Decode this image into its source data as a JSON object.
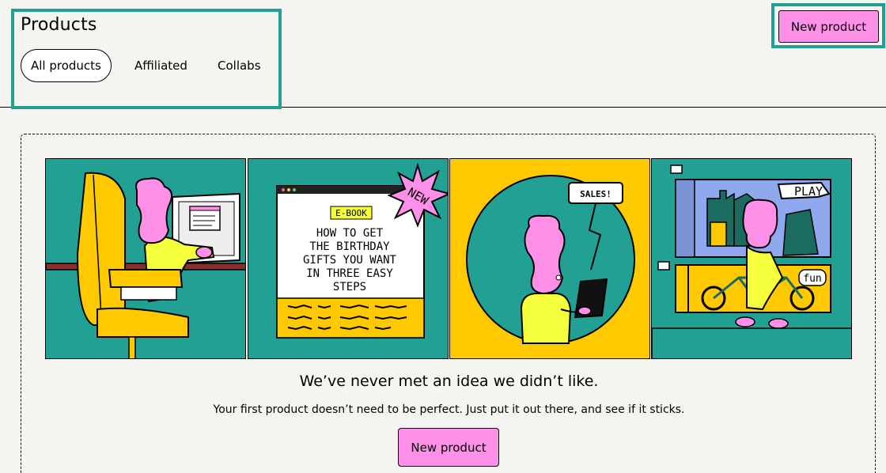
{
  "header": {
    "title": "Products",
    "tabs": [
      {
        "label": "All products",
        "active": true
      },
      {
        "label": "Affiliated",
        "active": false
      },
      {
        "label": "Collabs",
        "active": false
      }
    ],
    "new_product_label": "New product"
  },
  "empty_state": {
    "headline": "We’ve never met an idea we didn’t like.",
    "subline": "Your first product doesn’t need to be perfect. Just put it out there, and see if it sticks.",
    "cta_label": "New product",
    "illustrations": {
      "ebook_badge": "E-BOOK",
      "ebook_title_lines": [
        "HOW TO GET",
        "THE BIRTHDAY",
        "GIFTS YOU WANT",
        "IN THREE EASY",
        "STEPS"
      ],
      "new_burst": "NEW",
      "speech_bubble": "SALES!",
      "play_sign": "PLAY",
      "fun_sign": "fun"
    }
  },
  "colors": {
    "accent_teal": "#23a094",
    "brand_pink": "#ff90e8",
    "yellow": "#ffc900",
    "background": "#f4f4f0"
  }
}
